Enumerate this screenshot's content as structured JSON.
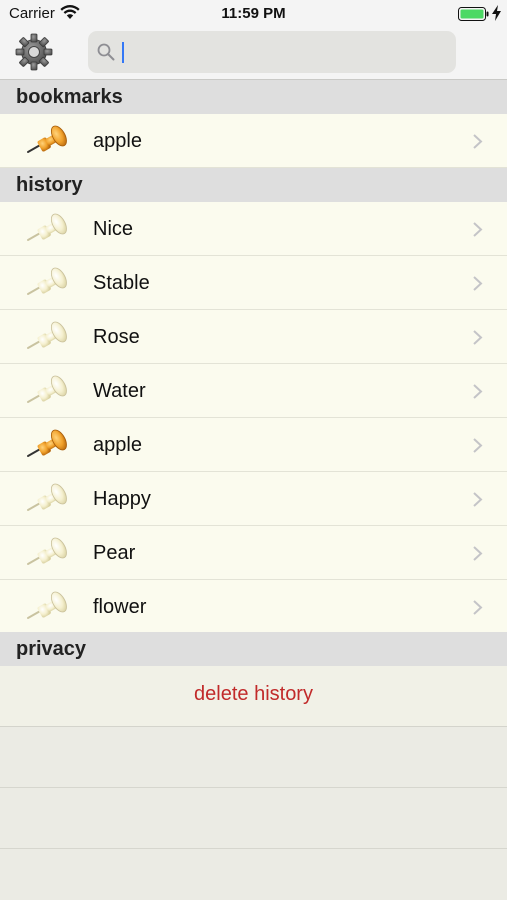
{
  "status_bar": {
    "carrier": "Carrier",
    "time": "11:59 PM"
  },
  "search": {
    "placeholder": "",
    "value": ""
  },
  "sections": {
    "bookmarks": {
      "title": "bookmarks",
      "items": [
        {
          "label": "apple",
          "pin": "orange"
        }
      ]
    },
    "history": {
      "title": "history",
      "items": [
        {
          "label": "Nice",
          "pin": "cream"
        },
        {
          "label": "Stable",
          "pin": "cream"
        },
        {
          "label": "Rose",
          "pin": "cream"
        },
        {
          "label": "Water",
          "pin": "cream"
        },
        {
          "label": "apple",
          "pin": "orange"
        },
        {
          "label": "Happy",
          "pin": "cream"
        },
        {
          "label": "Pear",
          "pin": "cream"
        },
        {
          "label": "flower",
          "pin": "cream"
        }
      ]
    },
    "privacy": {
      "title": "privacy",
      "action_label": "delete history"
    }
  },
  "colors": {
    "destructive": "#c12a2a",
    "row_bg": "#fbfbee",
    "header_bg": "#dedede",
    "battery": "#4cd964"
  },
  "icons": {
    "settings": "gear-icon",
    "search": "search-icon",
    "bookmarked_pin": "orange-pushpin-icon",
    "history_pin": "cream-pushpin-icon",
    "disclosure": "chevron-right-icon"
  }
}
